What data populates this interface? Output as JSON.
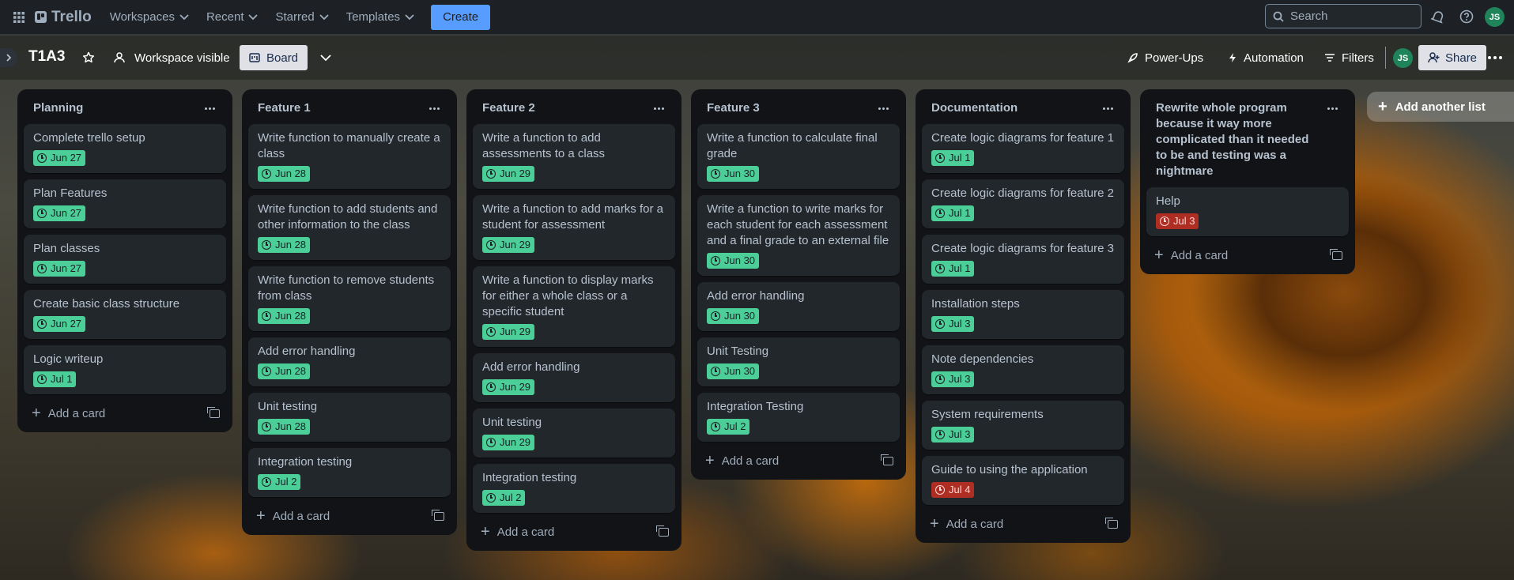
{
  "topnav": {
    "logo": "Trello",
    "menus": [
      "Workspaces",
      "Recent",
      "Starred",
      "Templates"
    ],
    "create": "Create",
    "search_placeholder": "Search",
    "avatar": "JS"
  },
  "boardbar": {
    "title": "T1A3",
    "visibility": "Workspace visible",
    "view": "Board",
    "powerups": "Power-Ups",
    "automation": "Automation",
    "filters": "Filters",
    "share": "Share",
    "avatar": "JS"
  },
  "add_card_label": "Add a card",
  "add_list_label": "Add another list",
  "lists": [
    {
      "title": "Planning",
      "cards": [
        {
          "title": "Complete trello setup",
          "due": "Jun 27",
          "status": "complete"
        },
        {
          "title": "Plan Features",
          "due": "Jun 27",
          "status": "complete"
        },
        {
          "title": "Plan classes",
          "due": "Jun 27",
          "status": "complete"
        },
        {
          "title": "Create basic class structure",
          "due": "Jun 27",
          "status": "complete"
        },
        {
          "title": "Logic writeup",
          "due": "Jul 1",
          "status": "complete"
        }
      ]
    },
    {
      "title": "Feature 1",
      "cards": [
        {
          "title": "Write function to manually create a class",
          "due": "Jun 28",
          "status": "complete"
        },
        {
          "title": "Write function to add students and other information to the class",
          "due": "Jun 28",
          "status": "complete"
        },
        {
          "title": "Write function to remove students from class",
          "due": "Jun 28",
          "status": "complete"
        },
        {
          "title": "Add error handling",
          "due": "Jun 28",
          "status": "complete"
        },
        {
          "title": "Unit testing",
          "due": "Jun 28",
          "status": "complete"
        },
        {
          "title": "Integration testing",
          "due": "Jul 2",
          "status": "complete"
        }
      ]
    },
    {
      "title": "Feature 2",
      "cards": [
        {
          "title": "Write a function to add assessments to a class",
          "due": "Jun 29",
          "status": "complete"
        },
        {
          "title": "Write a function to add marks for a student for assessment",
          "due": "Jun 29",
          "status": "complete"
        },
        {
          "title": "Write a function to display marks for either a whole class or a specific student",
          "due": "Jun 29",
          "status": "complete"
        },
        {
          "title": "Add error handling",
          "due": "Jun 29",
          "status": "complete"
        },
        {
          "title": "Unit testing",
          "due": "Jun 29",
          "status": "complete"
        },
        {
          "title": "Integration testing",
          "due": "Jul 2",
          "status": "complete"
        }
      ]
    },
    {
      "title": "Feature 3",
      "cards": [
        {
          "title": "Write a function to calculate final grade",
          "due": "Jun 30",
          "status": "complete"
        },
        {
          "title": "Write a function to write marks for each student for each assessment and a final grade to an external file",
          "due": "Jun 30",
          "status": "complete"
        },
        {
          "title": "Add error handling",
          "due": "Jun 30",
          "status": "complete"
        },
        {
          "title": "Unit Testing",
          "due": "Jun 30",
          "status": "complete"
        },
        {
          "title": "Integration Testing",
          "due": "Jul 2",
          "status": "complete"
        }
      ]
    },
    {
      "title": "Documentation",
      "cards": [
        {
          "title": "Create logic diagrams for feature 1",
          "due": "Jul 1",
          "status": "complete"
        },
        {
          "title": "Create logic diagrams for feature 2",
          "due": "Jul 1",
          "status": "complete"
        },
        {
          "title": "Create logic diagrams for feature 3",
          "due": "Jul 1",
          "status": "complete"
        },
        {
          "title": "Installation steps",
          "due": "Jul 3",
          "status": "complete"
        },
        {
          "title": "Note dependencies",
          "due": "Jul 3",
          "status": "complete"
        },
        {
          "title": "System requirements",
          "due": "Jul 3",
          "status": "complete"
        },
        {
          "title": "Guide to using the application",
          "due": "Jul 4",
          "status": "overdue"
        }
      ]
    },
    {
      "title": "Rewrite whole program because it way more complicated than it needed to be and testing was a nightmare",
      "cards": [
        {
          "title": "Help",
          "due": "Jul 3",
          "status": "overdue"
        }
      ]
    }
  ],
  "colors": {
    "complete": "#4bce97",
    "overdue": "#ae2e24",
    "accent": "#579dff",
    "list_bg": "#111316",
    "card_bg": "#22272b"
  }
}
